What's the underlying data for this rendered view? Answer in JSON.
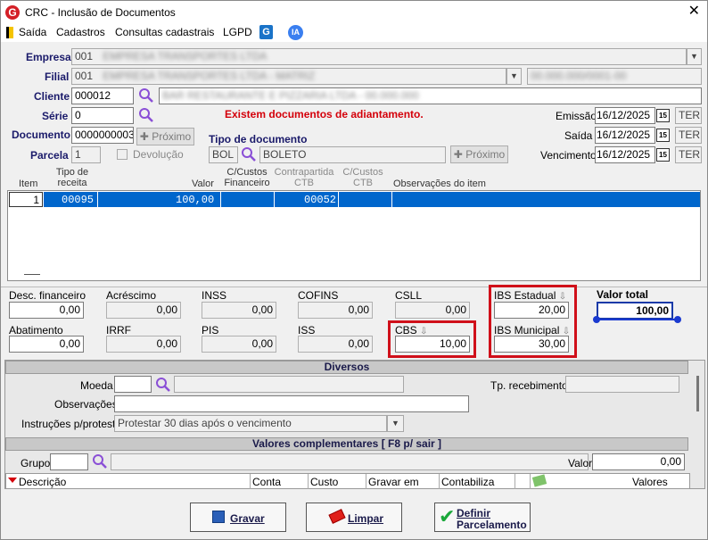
{
  "window": {
    "title": "CRC - Inclusão de Documentos"
  },
  "menu": {
    "items": [
      "Saída",
      "Cadastros",
      "Consultas cadastrais",
      "LGPD"
    ],
    "ia_label": "IA"
  },
  "form": {
    "empresa_label": "Empresa",
    "empresa_code": "001",
    "empresa_name": "EMPRESA TRANSPORTES LTDA",
    "filial_label": "Filial",
    "filial_code": "001",
    "filial_name": "EMPRESA TRANSPORTES LTDA - MATRIZ",
    "filial_cnpj": "00.000.000/0001-00",
    "cliente_label": "Cliente",
    "cliente_code": "000012",
    "cliente_name": "BAR RESTAURANTE E PIZZARIA LTDA - 00.000.000",
    "serie_label": "Série",
    "serie_value": "0",
    "warning": "Existem documentos de adiantamento.",
    "documento_label": "Documento",
    "documento_value": "0000000003",
    "proximo_label": "Próximo",
    "tipo_doc_label": "Tipo de documento",
    "tipo_doc_code": "BOL",
    "tipo_doc_name": "BOLETO",
    "parcela_label": "Parcela",
    "parcela_value": "1",
    "devolucao_label": "Devolução",
    "emissao_label": "Emissão",
    "emissao_value": "16/12/2025",
    "emissao_day": "TER",
    "saida_label": "Saída",
    "saida_value": "16/12/2025",
    "saida_day": "TER",
    "vencimento_label": "Vencimento",
    "vencimento_value": "16/12/2025",
    "vencimento_day": "TER",
    "cal_icon": "15"
  },
  "grid": {
    "col_item": "Item",
    "col_tipo": "Tipo de receita",
    "col_valor": "Valor",
    "col_ccf": "C/Custos Financeiro",
    "col_contra": "Contrapartida CTB",
    "col_ccc": "C/Custos CTB",
    "col_obs": "Observações do item",
    "row": {
      "item": "1",
      "tipo": "00095",
      "valor": "100,00",
      "contra": "00052"
    }
  },
  "totals": {
    "desc_fin_label": "Desc. financeiro",
    "desc_fin": "0,00",
    "acrescimo_label": "Acréscimo",
    "acrescimo": "0,00",
    "inss_label": "INSS",
    "inss": "0,00",
    "cofins_label": "COFINS",
    "cofins": "0,00",
    "csll_label": "CSLL",
    "csll": "0,00",
    "ibs_est_label": "IBS Estadual",
    "ibs_est": "20,00",
    "valor_total_label": "Valor total",
    "valor_total": "100,00",
    "abatimento_label": "Abatimento",
    "abatimento": "0,00",
    "irrf_label": "IRRF",
    "irrf": "0,00",
    "pis_label": "PIS",
    "pis": "0,00",
    "iss_label": "ISS",
    "iss": "0,00",
    "cbs_label": "CBS",
    "cbs": "10,00",
    "ibs_mun_label": "IBS Municipal",
    "ibs_mun": "30,00"
  },
  "diversos": {
    "title": "Diversos",
    "moeda_label": "Moeda",
    "tp_receb_label": "Tp. recebimento",
    "obs_label": "Observações",
    "instr_label": "Instruções p/protesto",
    "instr_value": "Protestar 30 dias após o vencimento"
  },
  "complementares": {
    "title": "Valores complementares [ F8 p/ sair ]",
    "grupo_label": "Grupo",
    "valor_label": "Valor",
    "valor_value": "0,00",
    "cols": [
      "Descrição",
      "Conta",
      "Custo",
      "Gravar em",
      "Contabiliza",
      "Valores"
    ]
  },
  "buttons": {
    "gravar": "Gravar",
    "limpar": "Limpar",
    "definir_1": "Definir",
    "definir_2": "Parcelamento"
  }
}
